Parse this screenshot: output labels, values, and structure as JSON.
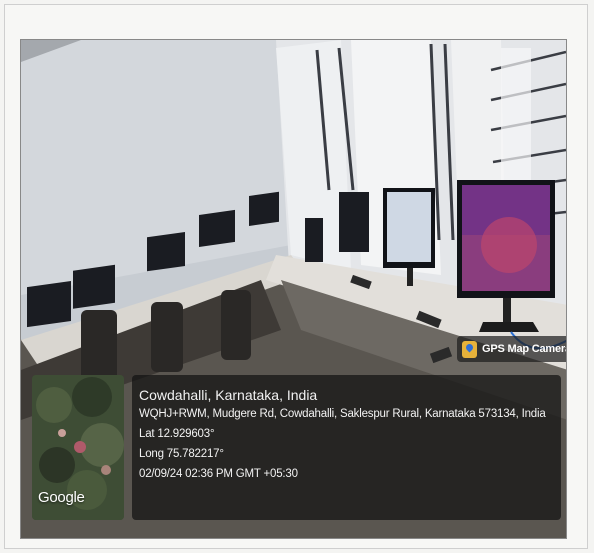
{
  "badge": {
    "label": "GPS Map Camera",
    "icon": "map-pin-icon"
  },
  "thumbnail": {
    "logo_text": "Google"
  },
  "location": {
    "title": "Cowdahalli, Karnataka, India",
    "address": "WQHJ+RWM, Mudgere Rd, Cowdahalli, Saklespur Rural, Karnataka 573134, India",
    "lat": "Lat 12.929603°",
    "long": "Long 75.782217°",
    "datetime": "02/09/24 02:36 PM GMT +05:30"
  },
  "colors": {
    "overlay": "#121212",
    "badge_icon": "#e7b23a",
    "wall": "#cfd3d8",
    "desk": "#d9d6d0"
  }
}
